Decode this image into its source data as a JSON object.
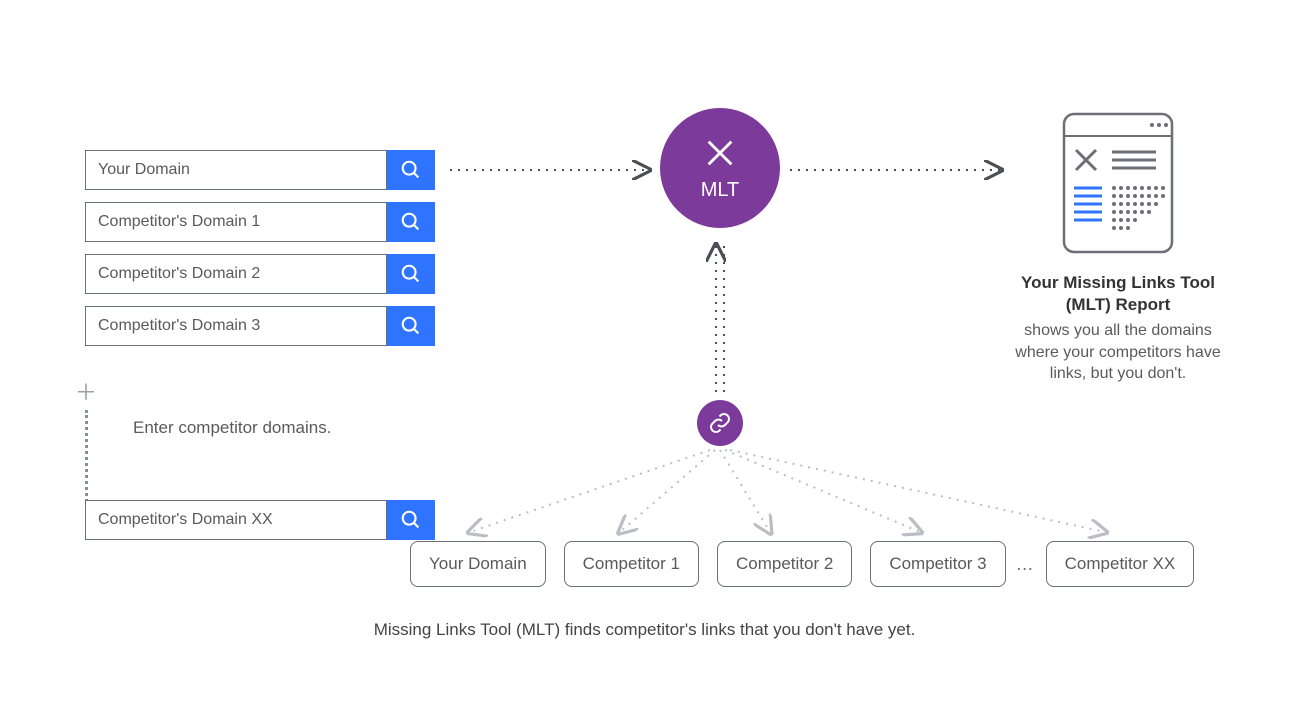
{
  "inputs": {
    "rows": [
      {
        "placeholder": "Your Domain"
      },
      {
        "placeholder": "Competitor's Domain 1"
      },
      {
        "placeholder": "Competitor's Domain 2"
      },
      {
        "placeholder": "Competitor's Domain 3"
      }
    ],
    "last": {
      "placeholder": "Competitor's Domain XX"
    },
    "enter_label": "Enter competitor domains."
  },
  "mlt": {
    "label": "MLT"
  },
  "report": {
    "title": "Your Missing Links Tool (MLT) Report",
    "desc": "shows you all the domains where your competitors have links, but you don't."
  },
  "boxes": {
    "your": "Your Domain",
    "c1": "Competitor 1",
    "c2": "Competitor 2",
    "c3": "Competitor 3",
    "cx": "Competitor XX",
    "ellipsis": "…"
  },
  "caption": "Missing Links Tool (MLT) finds competitor's links that you don't have yet.",
  "colors": {
    "purple": "#7c3b9b",
    "blue": "#2f74ff",
    "grey": "#6b6f76"
  }
}
